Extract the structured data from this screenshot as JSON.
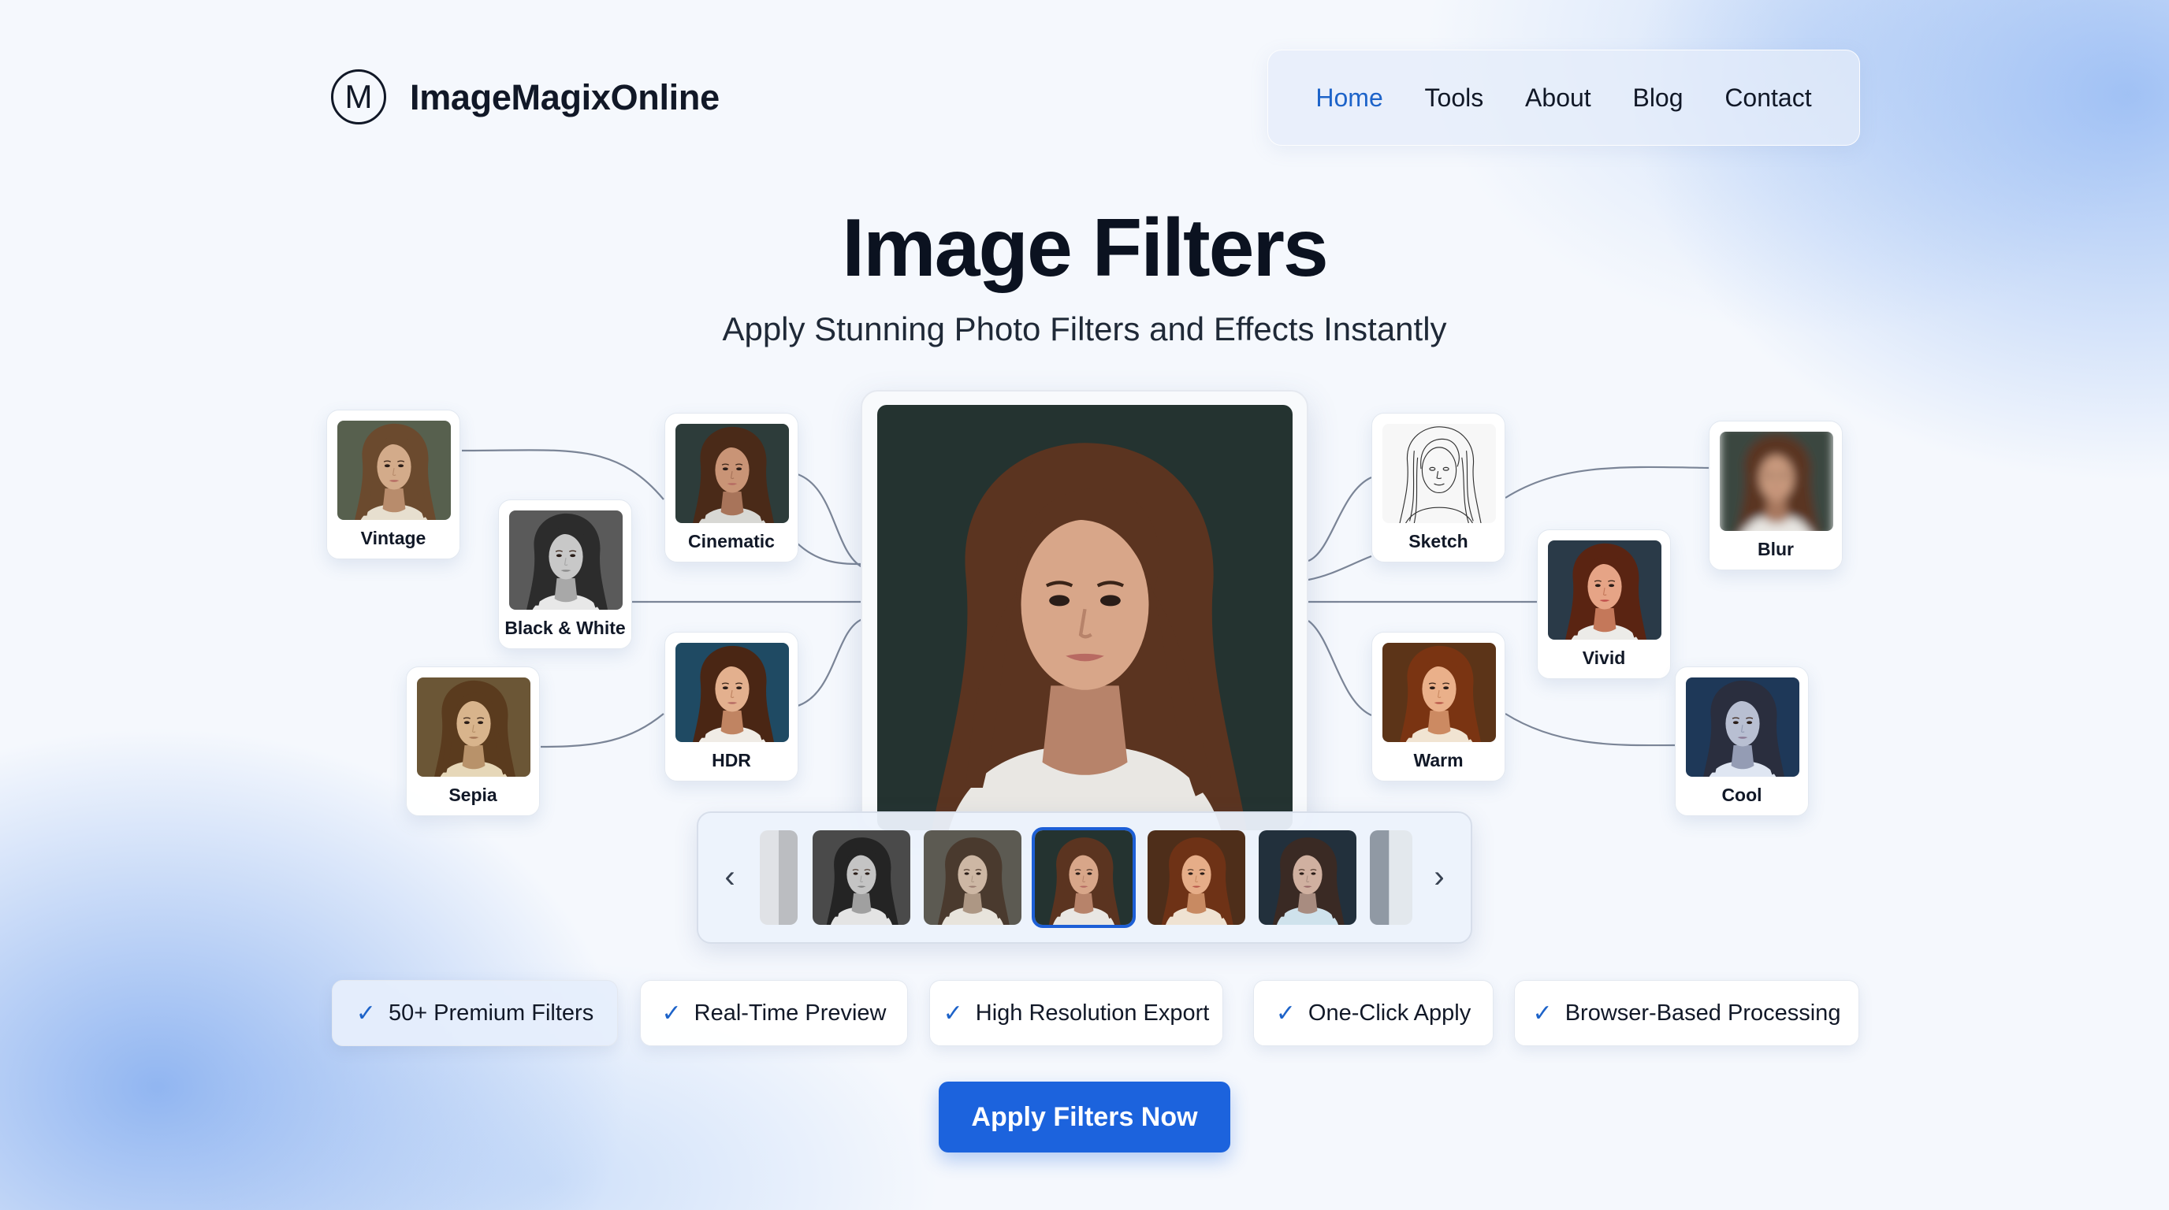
{
  "header": {
    "logo_letter": "M",
    "brand": "ImageMagixOnline",
    "nav": [
      {
        "label": "Home",
        "active": true
      },
      {
        "label": "Tools",
        "active": false
      },
      {
        "label": "About",
        "active": false
      },
      {
        "label": "Blog",
        "active": false
      },
      {
        "label": "Contact",
        "active": false
      }
    ]
  },
  "hero": {
    "title": "Image Filters",
    "subtitle": "Apply Stunning Photo Filters and Effects Instantly"
  },
  "filters": {
    "vintage": "Vintage",
    "black_white": "Black & White",
    "sepia": "Sepia",
    "cinematic": "Cinematic",
    "hdr": "HDR",
    "sketch": "Sketch",
    "vivid": "Vivid",
    "warm": "Warm",
    "blur": "Blur",
    "cool": "Cool"
  },
  "carousel": {
    "prev_icon": "chevron-left-icon",
    "next_icon": "chevron-right-icon",
    "prev_glyph": "‹",
    "next_glyph": "›",
    "selected_index": 2
  },
  "features": [
    "50+ Premium Filters",
    "Real-Time Preview",
    "High Resolution Export",
    "One-Click Apply",
    "Browser-Based Processing"
  ],
  "check_glyph": "✓",
  "cta": {
    "label": "Apply Filters Now"
  },
  "colors": {
    "accent": "#1c63dd",
    "nav_active": "#1d63c9",
    "title": "#0b1220"
  }
}
